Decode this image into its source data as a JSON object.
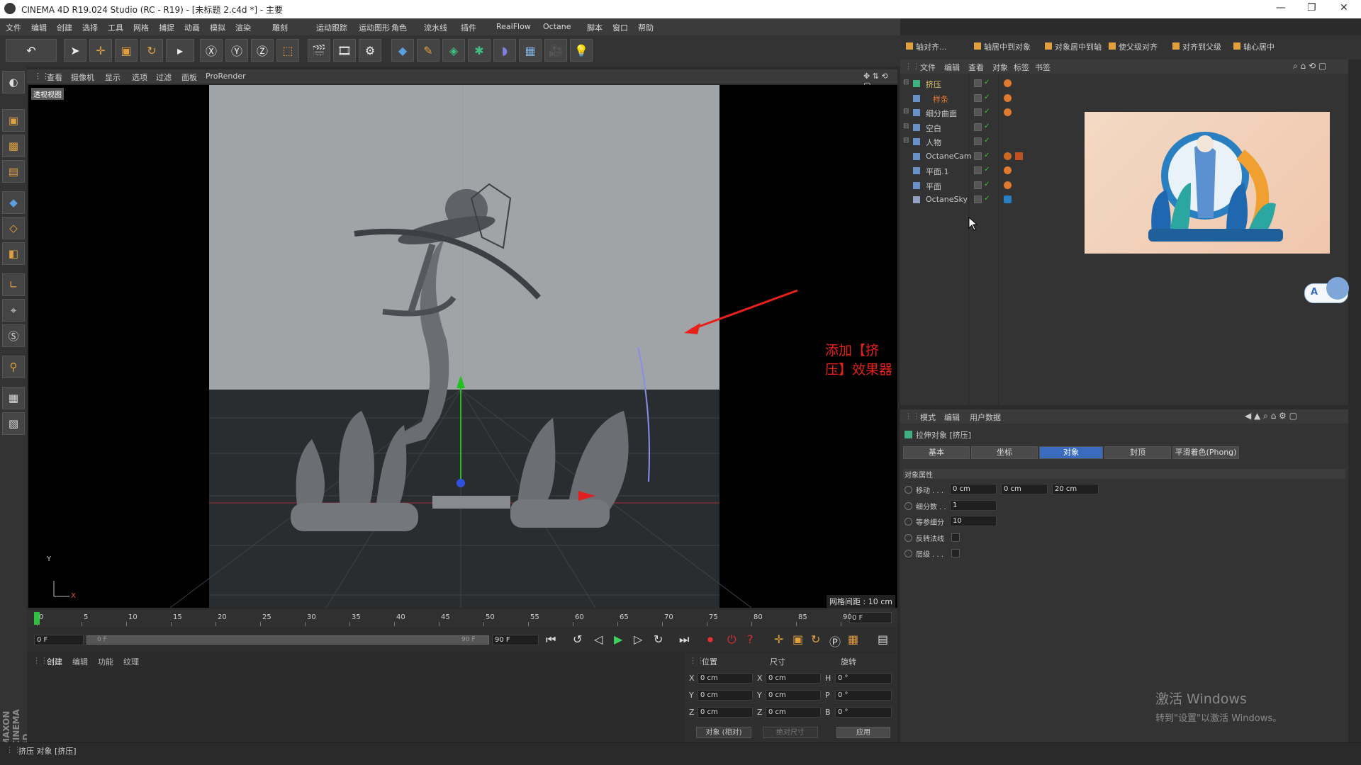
{
  "titlebar": {
    "title": "CINEMA 4D R19.024 Studio (RC - R19) - [未标题 2.c4d *] - 主要"
  },
  "menu": {
    "items": [
      "文件",
      "编辑",
      "创建",
      "选择",
      "工具",
      "网格",
      "捕捉",
      "动画",
      "模拟",
      "渲染",
      "雕刻",
      "运动跟踪",
      "运动图形",
      "角色",
      "流水线",
      "插件",
      "RealFlow",
      "Octane",
      "脚本",
      "窗口",
      "帮助"
    ]
  },
  "viewport": {
    "menu": [
      "查看",
      "摄像机",
      "显示",
      "选项",
      "过滤",
      "面板",
      "ProRender"
    ],
    "label": "透视视图",
    "grid_spacing": "网格间距 : 10 cm",
    "annotation": "添加【挤压】效果器",
    "axis_y": "Y",
    "axis_x": "X"
  },
  "timeline": {
    "ticks": [
      "0",
      "5",
      "10",
      "15",
      "20",
      "25",
      "30",
      "35",
      "40",
      "45",
      "50",
      "55",
      "60",
      "65",
      "70",
      "75",
      "80",
      "85",
      "90"
    ],
    "current_frame": "0 F",
    "start_frame": "0 F",
    "range_start": "0 F",
    "range_end": "90 F",
    "end_frame": "90 F"
  },
  "material_panel": {
    "menu": [
      "创建",
      "编辑",
      "功能",
      "纹理"
    ]
  },
  "coords": {
    "headers": [
      "位置",
      "尺寸",
      "旋转"
    ],
    "rows": [
      {
        "a": "X",
        "pos": "0 cm",
        "b": "X",
        "size": "0 cm",
        "c": "H",
        "rot": "0 °"
      },
      {
        "a": "Y",
        "pos": "0 cm",
        "b": "Y",
        "size": "0 cm",
        "c": "P",
        "rot": "0 °"
      },
      {
        "a": "Z",
        "pos": "0 cm",
        "b": "Z",
        "size": "0 cm",
        "c": "B",
        "rot": "0 °"
      }
    ],
    "mode": "对象 (相对)",
    "size_mode": "绝对尺寸",
    "apply": "应用"
  },
  "status": {
    "text": "挤压 对象 [挤压]"
  },
  "right_toolbar": {
    "items": [
      "轴对齐...",
      "轴居中到对象",
      "对象居中到轴",
      "使父级对齐",
      "对齐到父级",
      "轴心居中"
    ]
  },
  "object_manager": {
    "menu": [
      "文件",
      "编辑",
      "查看",
      "对象",
      "标签",
      "书签"
    ],
    "objects": [
      {
        "name": "挤压",
        "color": "#e2c46a"
      },
      {
        "name": "样条",
        "color": "#e07a30"
      },
      {
        "name": "细分曲面",
        "color": "#c8c8c8"
      },
      {
        "name": "空白",
        "color": "#c8c8c8"
      },
      {
        "name": "人物",
        "color": "#c8c8c8"
      },
      {
        "name": "OctaneCam",
        "color": "#c8c8c8"
      },
      {
        "name": "平面.1",
        "color": "#c8c8c8"
      },
      {
        "name": "平面",
        "color": "#c8c8c8"
      },
      {
        "name": "OctaneSky",
        "color": "#c8c8c8"
      }
    ]
  },
  "attributes": {
    "menu": [
      "模式",
      "编辑",
      "用户数据"
    ],
    "object_title": "拉伸对象 [挤压]",
    "tabs": [
      "基本",
      "坐标",
      "对象",
      "封顶",
      "平滑着色(Phong)"
    ],
    "active_tab": "对象",
    "section": "对象属性",
    "props": [
      {
        "label": "移动 . . .",
        "values": [
          "0 cm",
          "0 cm",
          "20 cm"
        ]
      },
      {
        "label": "细分数 . .",
        "values": [
          "1"
        ]
      },
      {
        "label": "等参细分",
        "values": [
          "10"
        ]
      },
      {
        "label": "反转法线",
        "check": true
      },
      {
        "label": "层级 . . .",
        "check": true
      }
    ]
  },
  "windows_watermark": {
    "line1": "激活 Windows",
    "line2": "转到\"设置\"以激活 Windows。"
  },
  "colors": {
    "accent_blue": "#3a6bbf",
    "annotation_red": "#e8201a",
    "bg_dark": "#2b2b2b"
  }
}
